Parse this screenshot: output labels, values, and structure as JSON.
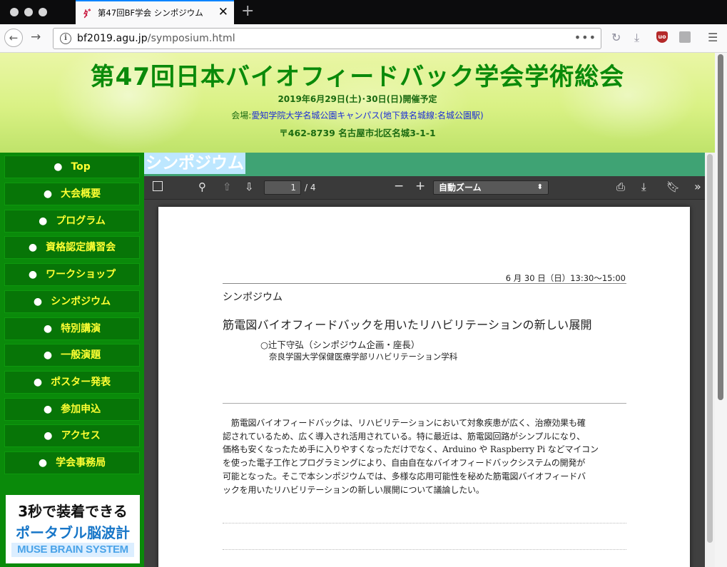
{
  "browser": {
    "tab_title": "第47回BF学会 シンポジウム",
    "tab_favicon": "ﾀﾞ",
    "url_domain": "bf2019.agu.jp",
    "url_path": "/symposium.html",
    "more_icon": "•••"
  },
  "banner": {
    "title": "第47回日本バイオフィードバック学会学術総会",
    "date": "2019年6月29日(土)･30日(日)開催予定",
    "venue_label": "会場:",
    "venue": "愛知学院大学名城公園キャンパス(地下鉄名城線:名城公園駅)",
    "address": "〒462-8739 名古屋市北区名城3-1-1"
  },
  "sidebar": {
    "items": [
      {
        "label": "Top"
      },
      {
        "label": "大会概要"
      },
      {
        "label": "プログラム"
      },
      {
        "label": "資格認定講習会"
      },
      {
        "label": "ワークショップ"
      },
      {
        "label": "シンポジウム"
      },
      {
        "label": "特別講演"
      },
      {
        "label": "一般演題"
      },
      {
        "label": "ポスター発表"
      },
      {
        "label": "参加申込"
      },
      {
        "label": "アクセス"
      },
      {
        "label": "学会事務局"
      }
    ]
  },
  "ad": {
    "line1": "3秒で装着できる",
    "line2": "ポータブル脳波計",
    "line3": "MUSE BRAIN SYSTEM"
  },
  "content": {
    "heading": "シンポジウム"
  },
  "pdf_viewer": {
    "page_current": "1",
    "page_total": "/ 4",
    "zoom": "自動ズーム",
    "page": {
      "date_time": "6 月 30 日（日）13:30〜15:00",
      "section": "シンポジウム",
      "title": "筋電図バイオフィードバックを用いたリハビリテーションの新しい展開",
      "presenter": "○辻下守弘（シンポジウム企画・座長）",
      "affiliation": "奈良学園大学保健医療学部リハビリテーション学科",
      "abstract_lines": [
        "　筋電図バイオフィードバックは、リハビリテーションにおいて対象疾患が広く、治療効果も確",
        "認されているため、広く導入され活用されている。特に最近は、筋電図回路がシンプルになり、",
        "価格も安くなったため手に入りやすくなっただけでなく、Arduino や Raspberry Pi などマイコン",
        "を使った電子工作とプログラミングにより、自由自在なバイオフィードバックシステムの開発が",
        "可能となった。そこで本シンポジウムでは、多様な応用可能性を秘めた筋電図バイオフィードバ",
        "ックを用いたリハビリテーションの新しい展開について議論したい。"
      ]
    }
  },
  "colors": {
    "sidebar_bg": "#0a8a0a",
    "sidebar_text": "#ffff33",
    "banner_title": "#0a8a0a",
    "heading_bar": "#3fa374"
  }
}
